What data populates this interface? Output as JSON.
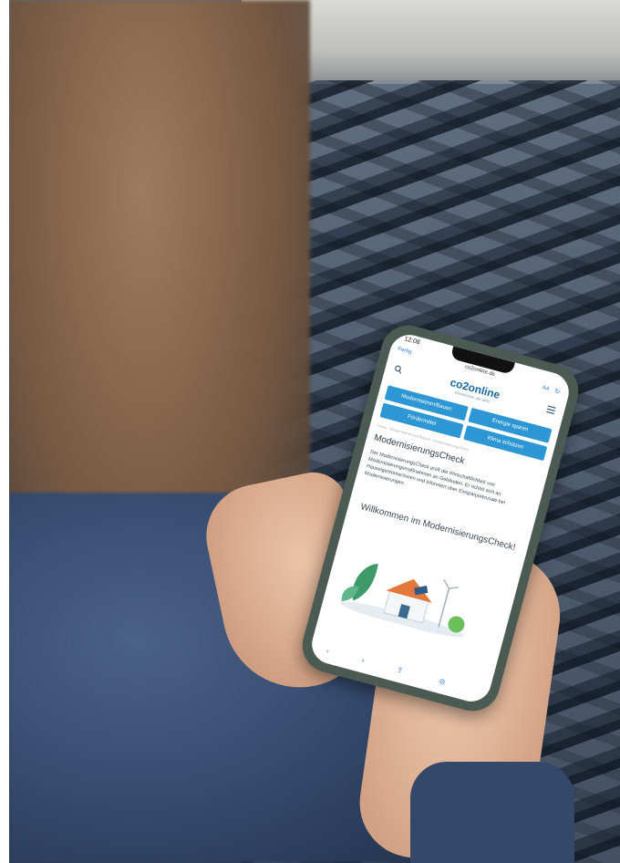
{
  "photo": {
    "description_free": true
  },
  "phone": {
    "status": {
      "time": "12:08"
    },
    "urlbar": {
      "back": "Fertig",
      "domain": "co2online.de",
      "text_size": "AA",
      "reload": "↻"
    },
    "header": {
      "logo": "co2online",
      "tagline": "Klimaschutz, der wirkt.",
      "search_icon": "search-icon",
      "menu_icon": "menu-icon"
    },
    "nav": [
      {
        "label": "Modernisieren/Bauen"
      },
      {
        "label": "Energie sparen"
      },
      {
        "label": "Fördermittel"
      },
      {
        "label": "Klima schützen"
      }
    ],
    "breadcrumb": "Home › Modernisieren und Bauen › Modernisierungscheck",
    "page": {
      "title": "ModernisierungsCheck",
      "description": "Der ModernisierungsCheck prüft die Wirtschaftlichkeit von Modernisierungsmaßnahmen an Gebäuden. Er richtet sich an Hauseigentümer/innen und informiert über Einsparpotenziale bei Modernisierungen.",
      "welcome": "Willkommen im ModernisierungsCheck!"
    },
    "toolbar": {
      "back": "‹",
      "forward": "›",
      "share": "⇪",
      "compass": "⊘"
    },
    "colors": {
      "accent": "#2d97d3",
      "logo": "#1c6aa0",
      "link": "#2b7de1"
    }
  }
}
